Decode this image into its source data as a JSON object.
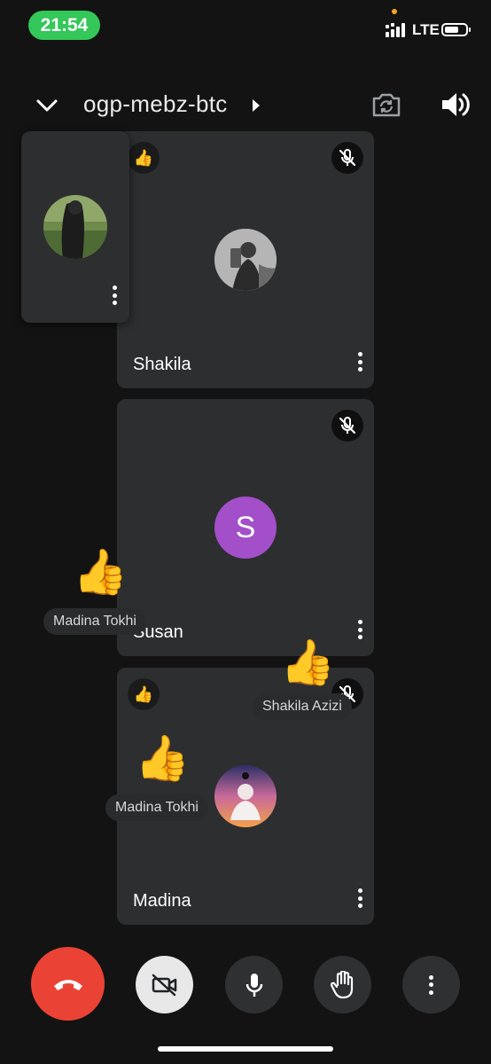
{
  "status_bar": {
    "time": "21:54",
    "network": "LTE"
  },
  "header": {
    "meeting_code": "ogp-mebz-btc",
    "icons": [
      "chevron-down-icon",
      "chevron-right-icon",
      "flip-camera-icon",
      "speaker-icon"
    ]
  },
  "self_view": {
    "icons": [
      "more-vert-icon"
    ]
  },
  "participants": [
    {
      "name": "Shakila",
      "muted": true,
      "reaction": "👍",
      "avatar": "photo"
    },
    {
      "name": "Susan",
      "muted": true,
      "reaction": "",
      "avatar_letter": "S",
      "avatar_color": "#a34fc9"
    },
    {
      "name": "Madina",
      "muted": true,
      "reaction": "👍",
      "avatar": "photo"
    }
  ],
  "floating_reactions": [
    {
      "emoji": "👍",
      "sender": "Madina Tokhi"
    },
    {
      "emoji": "👍",
      "sender": "Shakila Azizi"
    },
    {
      "emoji": "👍",
      "sender": "Madina Tokhi"
    }
  ],
  "controls": {
    "end_call_color": "#ea4335",
    "camera_button_color": "#e8e8e8",
    "icons": [
      "end-call-icon",
      "camera-off-icon",
      "mic-icon",
      "raise-hand-icon",
      "more-vert-icon"
    ]
  }
}
